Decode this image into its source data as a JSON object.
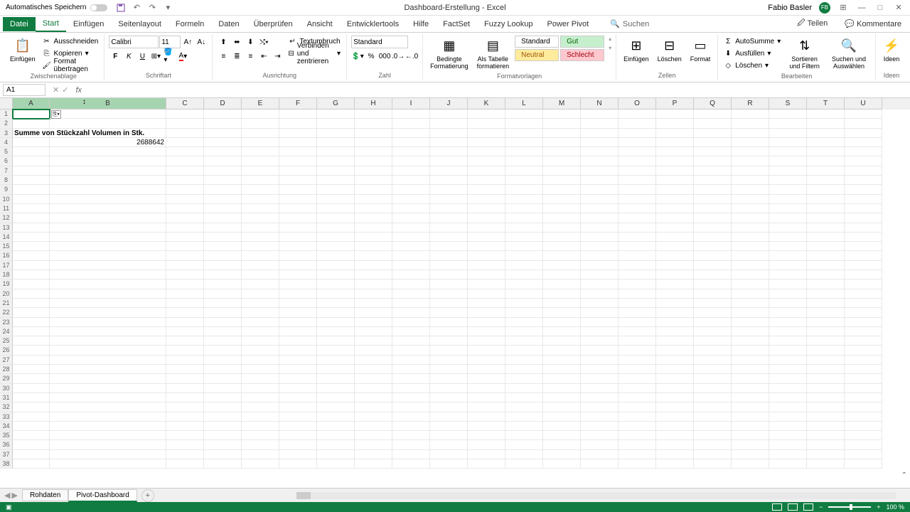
{
  "title_bar": {
    "autosave_label": "Automatisches Speichern",
    "doc_name": "Dashboard-Erstellung",
    "app_name": "Excel",
    "user_name": "Fabio Basler",
    "user_initials": "FB"
  },
  "tabs": {
    "file": "Datei",
    "items": [
      "Start",
      "Einfügen",
      "Seitenlayout",
      "Formeln",
      "Daten",
      "Überprüfen",
      "Ansicht",
      "Entwicklertools",
      "Hilfe",
      "FactSet",
      "Fuzzy Lookup",
      "Power Pivot"
    ],
    "active": "Start",
    "search": "Suchen",
    "share": "Teilen",
    "comments": "Kommentare"
  },
  "ribbon": {
    "clipboard": {
      "paste": "Einfügen",
      "cut": "Ausschneiden",
      "copy": "Kopieren",
      "format_painter": "Format übertragen",
      "label": "Zwischenablage"
    },
    "font": {
      "name": "Calibri",
      "size": "11",
      "label": "Schriftart"
    },
    "alignment": {
      "wrap": "Textumbruch",
      "merge": "Verbinden und zentrieren",
      "label": "Ausrichtung"
    },
    "number": {
      "format": "Standard",
      "label": "Zahl"
    },
    "styles": {
      "conditional": "Bedingte Formatierung",
      "as_table": "Als Tabelle formatieren",
      "standard": "Standard",
      "gut": "Gut",
      "neutral": "Neutral",
      "schlecht": "Schlecht",
      "label": "Formatvorlagen"
    },
    "cells": {
      "insert": "Einfügen",
      "delete": "Löschen",
      "format": "Format",
      "label": "Zellen"
    },
    "editing": {
      "autosum": "AutoSumme",
      "fill": "Ausfüllen",
      "clear": "Löschen",
      "sort": "Sortieren und Filtern",
      "find": "Suchen und Auswählen",
      "label": "Bearbeiten"
    },
    "ideas": {
      "btn": "Ideen",
      "label": "Ideen"
    }
  },
  "formula_bar": {
    "name_box": "A1"
  },
  "grid": {
    "columns": [
      "A",
      "B",
      "C",
      "D",
      "E",
      "F",
      "G",
      "H",
      "I",
      "J",
      "K",
      "L",
      "M",
      "N",
      "O",
      "P",
      "Q",
      "R",
      "S",
      "T",
      "U"
    ],
    "selected_cols": [
      "A",
      "B"
    ],
    "rows_visible": 38,
    "data": {
      "a3": "Summe von Stückzahl Volumen in Stk.",
      "b4": "2688642"
    }
  },
  "sheets": {
    "items": [
      "Rohdaten",
      "Pivot-Dashboard"
    ],
    "active": "Pivot-Dashboard"
  },
  "status": {
    "zoom": "100 %"
  }
}
